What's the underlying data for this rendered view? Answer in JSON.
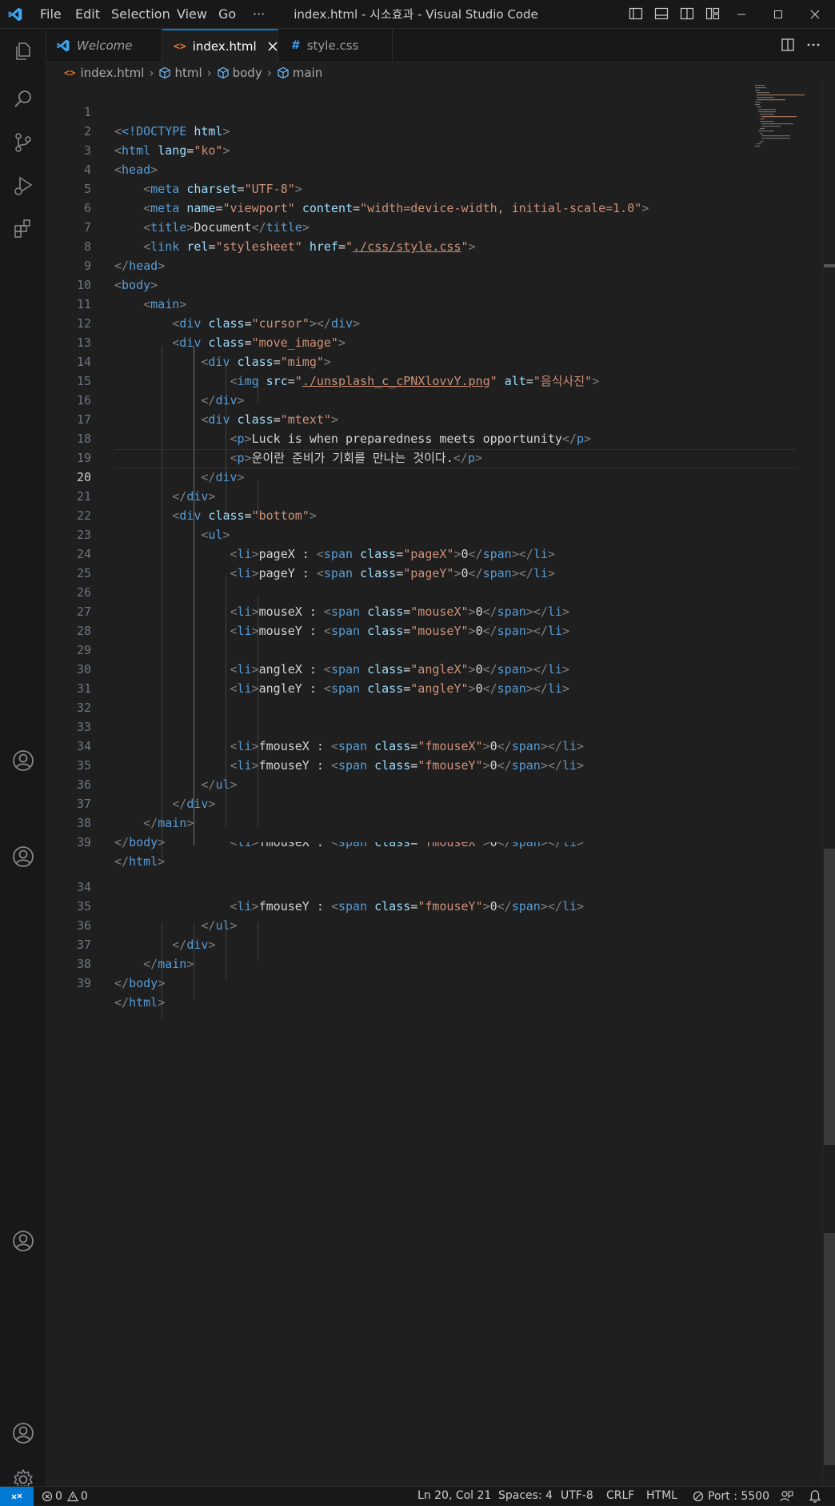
{
  "titlebar": {
    "menu": [
      "File",
      "Edit",
      "Selection",
      "View",
      "Go",
      "···"
    ],
    "title": "index.html - 시소효과 - Visual Studio Code"
  },
  "tabs": [
    {
      "label": "Welcome",
      "icon": "vscode-logo-icon"
    },
    {
      "label": "index.html",
      "icon": "html-file-icon",
      "active": true
    },
    {
      "label": "style.css",
      "icon": "css-file-icon"
    }
  ],
  "breadcrumb": [
    "index.html",
    "html",
    "body",
    "main"
  ],
  "editor": {
    "current_line": 20,
    "lines": [
      "1",
      "2",
      "3",
      "4",
      "5",
      "6",
      "7",
      "8",
      "9",
      "10",
      "11",
      "12",
      "13",
      "14",
      "15",
      "16",
      "17",
      "18",
      "19",
      "20",
      "21",
      "22",
      "23",
      "24",
      "25",
      "26",
      "27",
      "28",
      "29",
      "30",
      "31",
      "32",
      "33",
      "34",
      "35",
      "36",
      "37",
      "38",
      "39"
    ],
    "overflow_lines": [
      "33",
      "34",
      "35",
      "36",
      "37",
      "38",
      "39"
    ],
    "code": {
      "doctype": "<!DOCTYPE",
      "html_kw": "html",
      "html": "html",
      "lang": "lang",
      "ko": "\"ko\"",
      "head": "head",
      "meta": "meta",
      "charset": "charset",
      "utf8": "\"UTF-8\"",
      "name": "name",
      "viewport": "\"viewport\"",
      "content": "content",
      "content_val": "\"width=device-width, initial-scale=1.0\"",
      "title": "title",
      "document": "Document",
      "link": "link",
      "rel": "rel",
      "stylesheet": "\"stylesheet\"",
      "href": "href",
      "href_val": "./css/style.css",
      "body": "body",
      "main": "main",
      "div": "div",
      "class": "class",
      "cursor": "\"cursor\"",
      "move_image": "\"move_image\"",
      "mimg": "\"mimg\"",
      "img": "img",
      "src": "src",
      "src_val": "./unsplash_c_cPNXlovvY.png",
      "alt": "alt",
      "alt_val": "\"음식사진\"",
      "mtext": "\"mtext\"",
      "p": "p",
      "p1": "Luck is when preparedness meets opportunity",
      "p2": "운이란 준비가 기회를 만나는 것이다.",
      "bottom": "\"bottom\"",
      "ul": "ul",
      "li": "li",
      "span": "span",
      "zero": "0",
      "pageX_label": "pageX : ",
      "pageY_label": "pageY : ",
      "mouseX_label": "mouseX : ",
      "mouseY_label": "mouseY : ",
      "angleX_label": "angleX : ",
      "angleY_label": "angleY : ",
      "fmouseX_label": "fmouseX : ",
      "fmouseY_label": "fmouseY : ",
      "pageX": "\"pageX\"",
      "pageY": "\"pageY\"",
      "mouseX": "\"mouseX\"",
      "mouseY": "\"mouseY\"",
      "angleX": "\"angleX\"",
      "angleY": "\"angleY\"",
      "fmouseX": "\"fmouseX\"",
      "fmouseY": "\"fmouseY\""
    }
  },
  "status": {
    "errors": "0",
    "warnings": "0",
    "position": "Ln 20, Col 21",
    "spaces": "Spaces: 4",
    "encoding": "UTF-8",
    "eol": "CRLF",
    "language": "HTML",
    "port": "Port : 5500"
  },
  "colors": {
    "accent": "#0078d4",
    "tag": "#569cd6",
    "attr": "#9cdcfe",
    "string": "#ce9178",
    "bg": "#1f1f1f"
  }
}
